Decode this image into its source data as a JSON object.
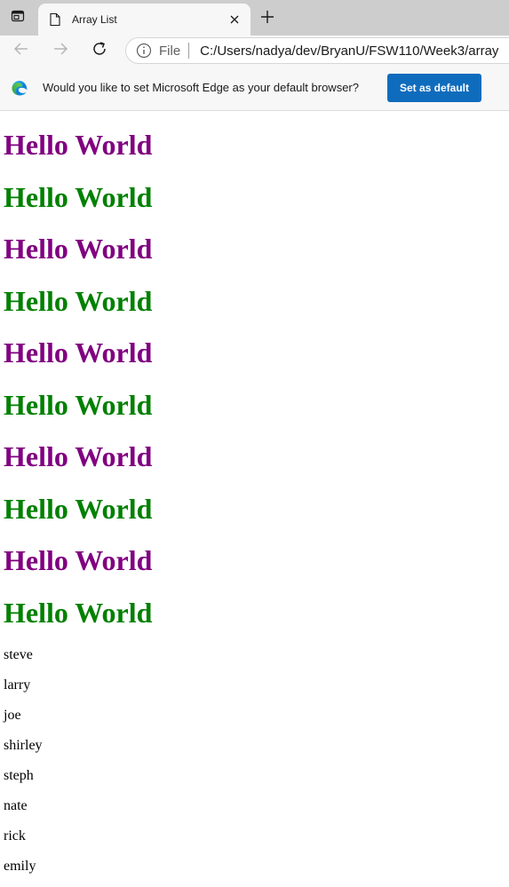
{
  "tab": {
    "title": "Array List"
  },
  "address_bar": {
    "scheme_label": "File",
    "url": "C:/Users/nadya/dev/BryanU/FSW110/Week3/array"
  },
  "infobar": {
    "message": "Would you like to set Microsoft Edge as your default browser?",
    "button_label": "Set as default"
  },
  "page": {
    "headings": [
      {
        "text": "Hello World",
        "color": "#800080"
      },
      {
        "text": "Hello World",
        "color": "#008000"
      },
      {
        "text": "Hello World",
        "color": "#800080"
      },
      {
        "text": "Hello World",
        "color": "#008000"
      },
      {
        "text": "Hello World",
        "color": "#800080"
      },
      {
        "text": "Hello World",
        "color": "#008000"
      },
      {
        "text": "Hello World",
        "color": "#800080"
      },
      {
        "text": "Hello World",
        "color": "#008000"
      },
      {
        "text": "Hello World",
        "color": "#800080"
      },
      {
        "text": "Hello World",
        "color": "#008000"
      }
    ],
    "names": [
      "steve",
      "larry",
      "joe",
      "shirley",
      "steph",
      "nate",
      "rick",
      "emily"
    ]
  },
  "icons": {
    "tab_actions": "tab-actions-icon",
    "favicon": "page-icon",
    "close": "close-icon",
    "new_tab": "plus-icon",
    "back": "back-arrow-icon",
    "forward": "forward-arrow-icon",
    "refresh": "refresh-icon",
    "site_info": "info-icon",
    "edge": "edge-logo-icon"
  },
  "colors": {
    "accent": "#0f6cbd",
    "purple": "#800080",
    "green": "#008000"
  }
}
